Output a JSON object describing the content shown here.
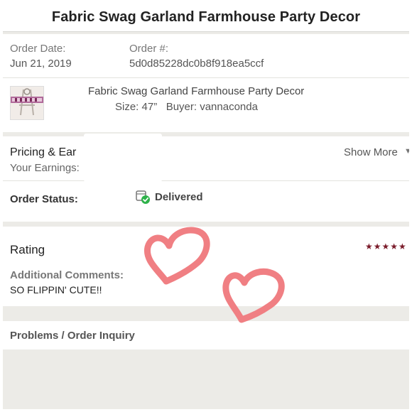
{
  "header": {
    "title": "Fabric Swag Garland Farmhouse Party Decor"
  },
  "order": {
    "date_label": "Order Date:",
    "date_value": "Jun 21, 2019",
    "number_label": "Order #:",
    "number_value": "5d0d85228dc0b8f918ea5ccf"
  },
  "item": {
    "title": "Fabric Swag Garland Farmhouse Party Decor",
    "attributes": "Size: 47”   Buyer: vannaconda"
  },
  "pricing": {
    "title": "Pricing & Ear",
    "earnings_label": "Your Earnings:",
    "show_more": "Show More",
    "show_more_icon": "chevron-down-icon"
  },
  "status": {
    "label": "Order Status:",
    "value": "Delivered",
    "icon": "delivered-package-check-icon"
  },
  "rating": {
    "label": "Rating",
    "stars": "★★★★★",
    "stars_shown": 5,
    "comments_label": "Additional Comments:",
    "comments_text": "SO FLIPPIN' CUTE!!"
  },
  "problems": {
    "label": "Problems / Order Inquiry"
  },
  "colors": {
    "star": "#7b1c2b",
    "delivered_check": "#2eb24a",
    "heart_outline": "#f07f83"
  }
}
